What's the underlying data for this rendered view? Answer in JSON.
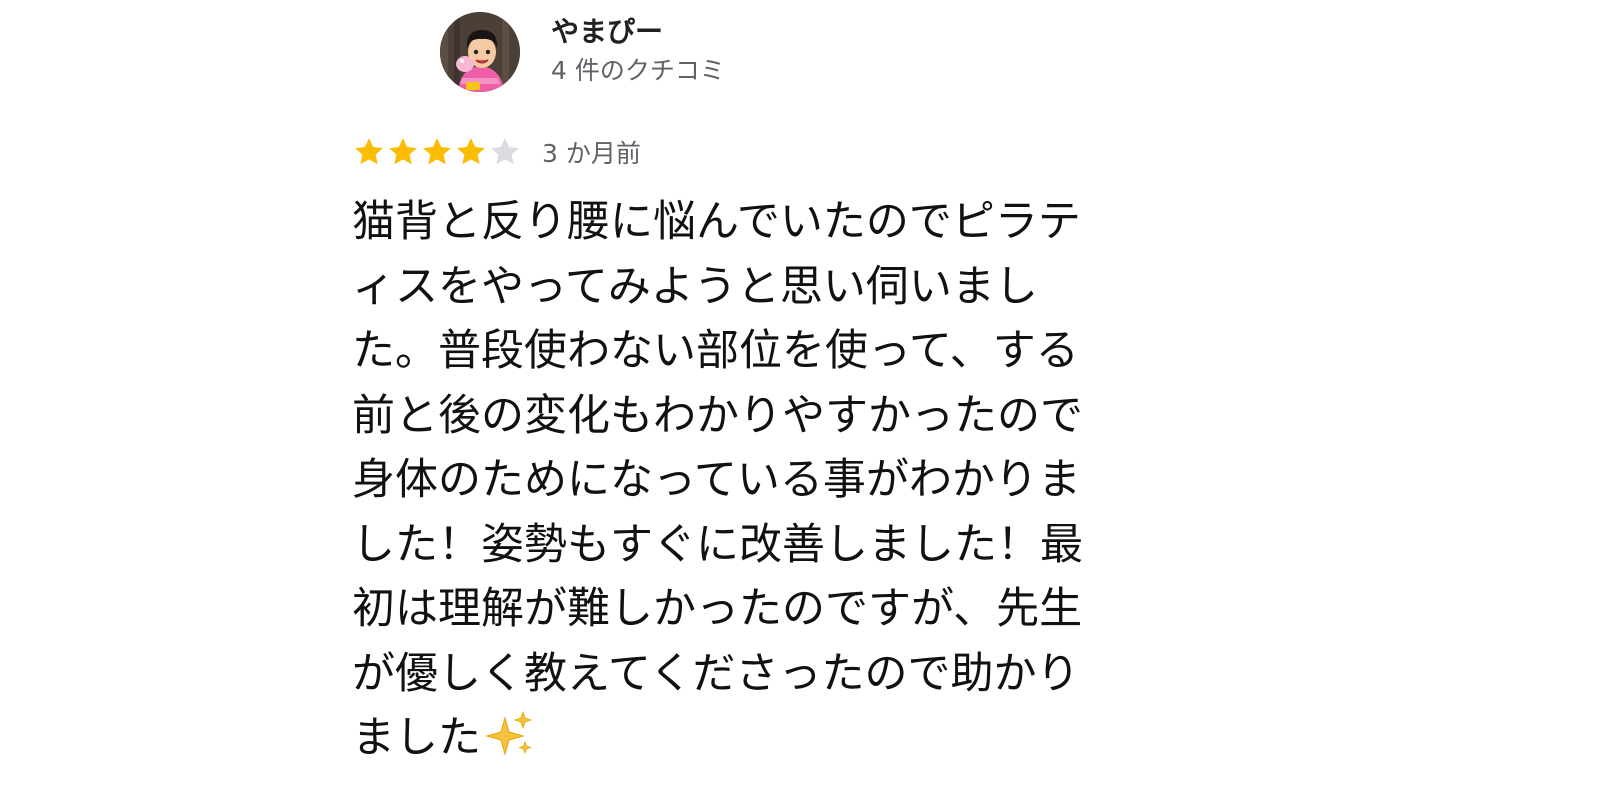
{
  "reviewer": {
    "name": "やまぴー",
    "review_count": "4 件のクチコミ",
    "avatar_icon": "cartoon-avatar"
  },
  "review": {
    "rating": 4,
    "max_rating": 5,
    "star_color": "#FBBC04",
    "star_empty_color": "#DADCE0",
    "date": "3 か月前",
    "text": "猫背と反り腰に悩んでいたのでピラティスをやってみようと思い伺いました。普段使わない部位を使って、する前と後の変化もわかりやすかったので身体のためになっている事がわかりました！姿勢もすぐに改善しました！最初は理解が難しかったのですが、先生が優しく教えてくださったので助かりました✨",
    "lines": [
      "猫背と反り腰に悩んでいたのでピラテ",
      "ィスをやってみようと思い伺いまし",
      "た。普段使わない部位を使って、する",
      "前と後の変化もわかりやすかったので",
      "身体のためになっている事がわかりま",
      "した！姿勢もすぐに改善しました！最",
      "初は理解が難しかったのですが、先生",
      "が優しく教えてくださったので助かり",
      "ました"
    ],
    "trailing_icon": "sparkles-icon"
  }
}
